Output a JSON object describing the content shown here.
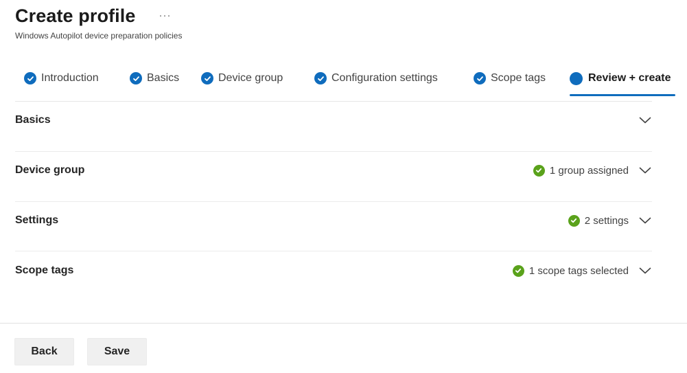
{
  "header": {
    "title": "Create profile",
    "more_label": "···",
    "subtitle": "Windows Autopilot device preparation policies"
  },
  "tabs": [
    {
      "label": "Introduction",
      "state": "complete"
    },
    {
      "label": "Basics",
      "state": "complete"
    },
    {
      "label": "Device group",
      "state": "complete"
    },
    {
      "label": "Configuration settings",
      "state": "complete"
    },
    {
      "label": "Scope tags",
      "state": "complete"
    },
    {
      "label": "Review + create",
      "state": "active"
    }
  ],
  "sections": [
    {
      "title": "Basics",
      "status": ""
    },
    {
      "title": "Device group",
      "status": "1 group assigned"
    },
    {
      "title": "Settings",
      "status": "2 settings"
    },
    {
      "title": "Scope tags",
      "status": "1 scope tags selected"
    }
  ],
  "footer": {
    "back_label": "Back",
    "save_label": "Save"
  },
  "colors": {
    "accent": "#0f6cbd",
    "success": "#5aa21b"
  },
  "icons": {
    "tab_complete": "check-circle-icon",
    "tab_active": "filled-circle-icon",
    "section_status": "success-check-icon",
    "section_toggle": "chevron-down-icon"
  }
}
